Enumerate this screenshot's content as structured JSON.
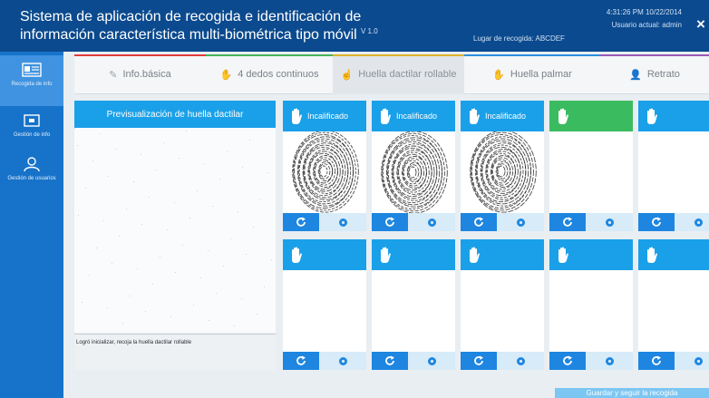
{
  "header": {
    "title": "Sistema de aplicación de recogida e identificación de información característica multi-biométrica tipo móvil",
    "version": "V 1.0",
    "collection_place": "Lugar de recogida: ABCDEF",
    "datetime": "4:31:26 PM 10/22/2014",
    "current_user": "Usuario actual: admin",
    "close_glyph": "×"
  },
  "sidebar": {
    "items": [
      {
        "label": "Recogida de info",
        "icon": "id-card-icon",
        "active": true
      },
      {
        "label": "Gestión de info",
        "icon": "database-icon",
        "active": false
      },
      {
        "label": "Gestión de usuarios",
        "icon": "user-icon",
        "active": false
      }
    ]
  },
  "tabs": [
    {
      "label": "Info.básica",
      "icon": "pencil-icon",
      "accent": "#e23b3b",
      "active": false
    },
    {
      "label": "4 dedos continuos",
      "icon": "hand-icon",
      "accent": "#47b35a",
      "active": false
    },
    {
      "label": "Huella dactilar rollable",
      "icon": "fingerprint-icon",
      "accent": "#e0b22a",
      "active": true
    },
    {
      "label": "Huella palmar",
      "icon": "palm-icon",
      "accent": "#2b8fe0",
      "active": false
    },
    {
      "label": "Retrato",
      "icon": "person-icon",
      "accent": "#9b59b6",
      "active": false
    }
  ],
  "preview": {
    "title": "Previsualización de huella dactilar",
    "status": "Logró inicializar, recoja la huella dactilar rollable"
  },
  "fingers_top": [
    {
      "label": "Incalificado",
      "state": "blue",
      "has_print": true
    },
    {
      "label": "Incalificado",
      "state": "blue",
      "has_print": true
    },
    {
      "label": "Incalificado",
      "state": "blue",
      "has_print": true
    },
    {
      "label": "",
      "state": "green",
      "has_print": false
    },
    {
      "label": "",
      "state": "blue",
      "has_print": false
    }
  ],
  "fingers_bottom": [
    {
      "label": "",
      "state": "blue",
      "has_print": false
    },
    {
      "label": "",
      "state": "blue",
      "has_print": false
    },
    {
      "label": "",
      "state": "blue",
      "has_print": false
    },
    {
      "label": "",
      "state": "blue",
      "has_print": false
    },
    {
      "label": "",
      "state": "blue",
      "has_print": false
    }
  ],
  "actions": {
    "save_label": "Guardar y seguir la recogida"
  },
  "colors": {
    "header_bg": "#0b4a8e",
    "sidebar_bg": "#1673c9",
    "accent_blue": "#1aa0e8",
    "accent_green": "#3bbb5f"
  }
}
